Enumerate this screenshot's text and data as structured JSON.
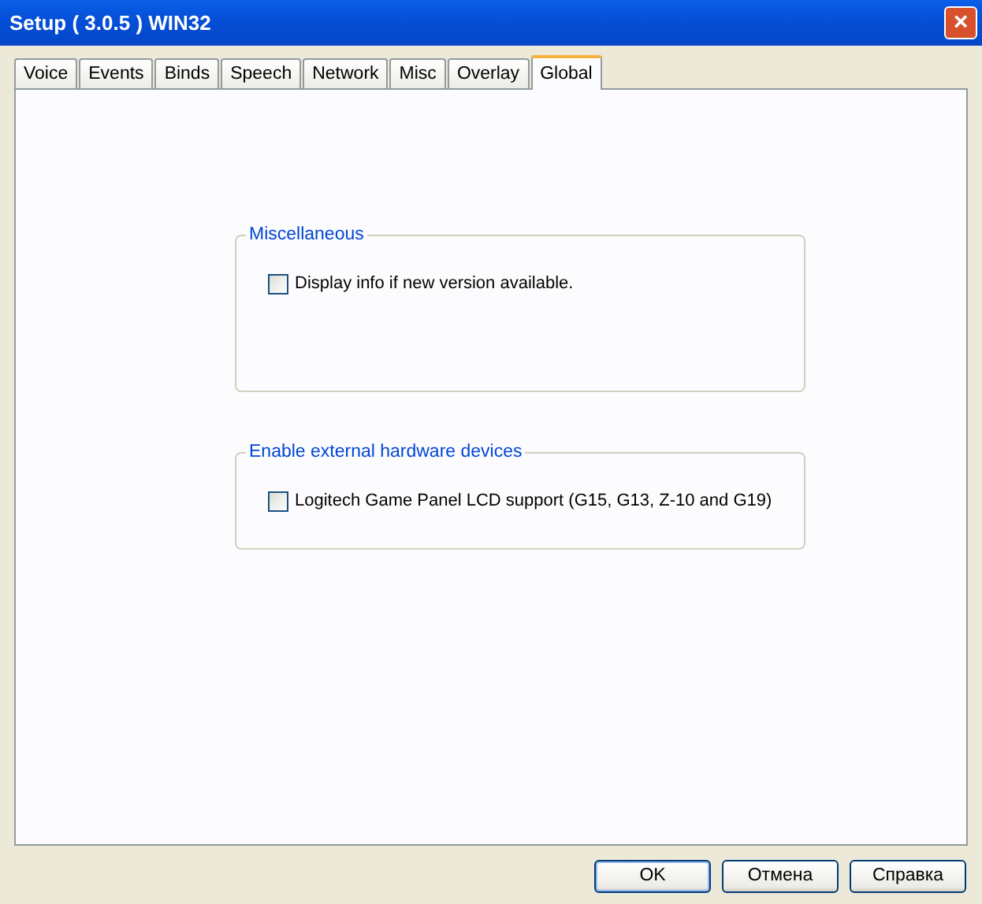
{
  "window": {
    "title": "Setup ( 3.0.5 ) WIN32",
    "close": "×"
  },
  "tabs": [
    {
      "label": "Voice",
      "selected": false
    },
    {
      "label": "Events",
      "selected": false
    },
    {
      "label": "Binds",
      "selected": false
    },
    {
      "label": "Speech",
      "selected": false
    },
    {
      "label": "Network",
      "selected": false
    },
    {
      "label": "Misc",
      "selected": false
    },
    {
      "label": "Overlay",
      "selected": false
    },
    {
      "label": "Global",
      "selected": true
    }
  ],
  "groups": [
    {
      "title": "Miscellaneous",
      "options": [
        {
          "label": "Display info if new version available.",
          "checked": false
        }
      ]
    },
    {
      "title": "Enable external hardware devices",
      "options": [
        {
          "label": "Logitech Game Panel LCD support (G15, G13, Z-10 and G19)",
          "checked": false
        }
      ]
    }
  ],
  "buttons": [
    {
      "label": "OK",
      "default": true
    },
    {
      "label": "Отмена",
      "default": false
    },
    {
      "label": "Справка",
      "default": false
    }
  ]
}
